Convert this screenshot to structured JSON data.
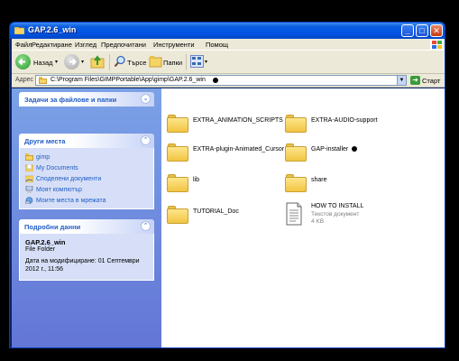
{
  "window": {
    "title": "GAP.2.6_win"
  },
  "menu": [
    "Файл",
    "Редактиране",
    "Изглед",
    "Предпочитани",
    "Инструменти",
    "Помощ"
  ],
  "toolbar": {
    "back_label": "Назад",
    "search_label": "Търсе",
    "folders_label": "Папки"
  },
  "address": {
    "label": "Адрес",
    "path": "C:\\Program Files\\GIMPPortable\\App\\gimp\\GAP.2.6_win",
    "go_label": "Старт"
  },
  "left_pane": {
    "tasks_header": "Задачи за файлове и папки",
    "places_header": "Други места",
    "places": [
      {
        "label": "gimp",
        "icon": "folder-icon"
      },
      {
        "label": "My Documents",
        "icon": "documents-icon"
      },
      {
        "label": "Споделени документи",
        "icon": "shared-folder-icon"
      },
      {
        "label": "Моят компютър",
        "icon": "computer-icon"
      },
      {
        "label": "Моите места в мрежата",
        "icon": "network-icon"
      }
    ],
    "details_header": "Подробни данни",
    "details": {
      "name": "GAP.2.6_win",
      "type": "File Folder",
      "modified": "Дата на модифициране: 01 Септември 2012 г., 11:56"
    }
  },
  "files": [
    {
      "name": "EXTRA_ANIMATION_SCRIPTS",
      "kind": "folder"
    },
    {
      "name": "EXTRA-AUDIO-support",
      "kind": "folder"
    },
    {
      "name": "EXTRA-plugin-Animated_Cursor",
      "kind": "folder"
    },
    {
      "name": "GAP-installer",
      "kind": "folder"
    },
    {
      "name": "lib",
      "kind": "folder"
    },
    {
      "name": "share",
      "kind": "folder"
    },
    {
      "name": "TUTORIAL_Doc",
      "kind": "folder"
    },
    {
      "name": "HOW TO INSTALL",
      "kind": "text",
      "type": "Текстов документ",
      "size": "4 KB"
    }
  ],
  "colors": {
    "titlebar": "#0055e5",
    "sidebar": "#6375d6",
    "link": "#215dc6",
    "folder": "#f2c542"
  }
}
